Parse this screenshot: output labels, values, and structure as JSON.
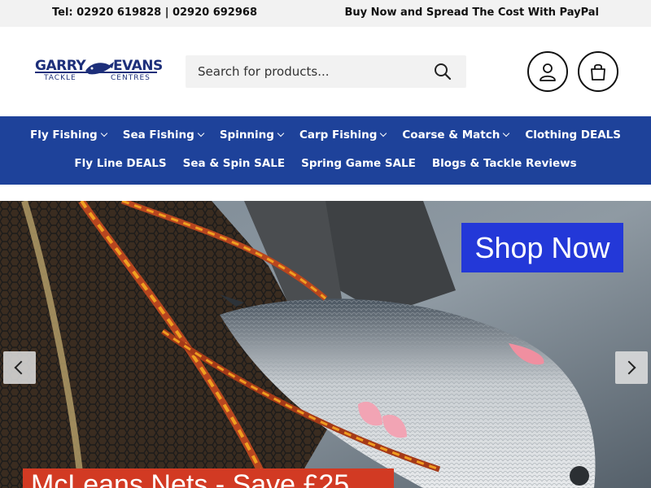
{
  "topbar": {
    "tel": "Tel: 02920 619828 | 02920 692968",
    "promo": "Buy Now and Spread The Cost With PayPal"
  },
  "logo": {
    "word1": "GARRY",
    "word2": "EVANS",
    "sub1": "TACKLE",
    "sub2": "CENTRES"
  },
  "search": {
    "placeholder": "Search for products..."
  },
  "icons": {
    "search": "search-icon",
    "account": "user-icon",
    "cart": "shopping-bag-icon",
    "prev": "chevron-left-icon",
    "next": "chevron-right-icon"
  },
  "nav": {
    "row1": [
      {
        "label": "Fly Fishing",
        "dropdown": true
      },
      {
        "label": "Sea Fishing",
        "dropdown": true
      },
      {
        "label": "Spinning",
        "dropdown": true
      },
      {
        "label": "Carp Fishing",
        "dropdown": true
      },
      {
        "label": "Coarse & Match",
        "dropdown": true
      },
      {
        "label": "Clothing DEALS",
        "dropdown": false
      }
    ],
    "row2": [
      {
        "label": "Fly Line DEALS"
      },
      {
        "label": "Sea & Spin SALE"
      },
      {
        "label": "Spring Game SALE"
      },
      {
        "label": "Blogs & Tackle Reviews"
      }
    ]
  },
  "hero": {
    "cta": "Shop Now",
    "banner": "McLeans Nets - Save £25"
  },
  "colors": {
    "nav_bg": "#1e429a",
    "cta_bg": "#2338d8",
    "banner_bg": "#d23a23",
    "topbar_bg": "#f2f2f2"
  }
}
